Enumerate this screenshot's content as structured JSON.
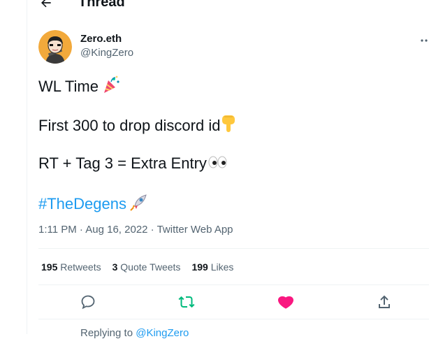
{
  "header": {
    "title": "Thread",
    "back_icon": "arrow-left-icon"
  },
  "author": {
    "name": "Zero.eth",
    "handle": "@KingZero"
  },
  "tweet": {
    "line1": "WL Time",
    "line2": "First 300 to drop discord id",
    "line3": "RT + Tag 3 = Extra Entry",
    "hashtag": "#TheDegens",
    "emojis": {
      "line1": "party-popper-icon",
      "line2": "pointing-down-icon",
      "line3": "eyes-icon",
      "hashtag": "rocket-icon"
    }
  },
  "meta": {
    "time": "1:11 PM",
    "sep1": " · ",
    "date": "Aug 16, 2022",
    "sep2": " · ",
    "source": "Twitter Web App"
  },
  "stats": {
    "retweets_count": "195",
    "retweets_label": "Retweets",
    "quotes_count": "3",
    "quotes_label": "Quote Tweets",
    "likes_count": "199",
    "likes_label": "Likes"
  },
  "actions": {
    "reply_icon": "reply-icon",
    "retweet_icon": "retweet-icon",
    "like_icon": "heart-icon",
    "share_icon": "share-icon"
  },
  "colors": {
    "accent": "#1d9bf0",
    "retweet_active": "#00ba7c",
    "like_active": "#f91880",
    "secondary_text": "#536471"
  },
  "reply_context": {
    "prefix": "Replying to ",
    "mention": "@KingZero"
  }
}
